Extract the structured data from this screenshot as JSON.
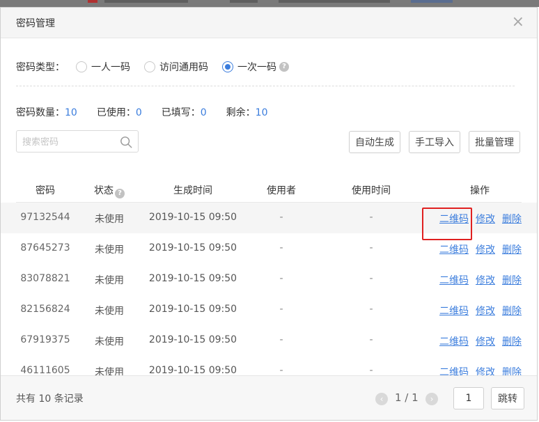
{
  "dialog": {
    "title": "密码管理",
    "close_symbol": "×"
  },
  "password_type": {
    "label": "密码类型：",
    "options": [
      {
        "label": "一人一码",
        "checked": false
      },
      {
        "label": "访问通用码",
        "checked": false
      },
      {
        "label": "一次一码",
        "checked": true
      }
    ],
    "help_symbol": "?"
  },
  "stats": {
    "count_label": "密码数量：",
    "count_value": "10",
    "used_label": "已使用：",
    "used_value": "0",
    "filled_label": "已填写：",
    "filled_value": "0",
    "remaining_label": "剩余：",
    "remaining_value": "10"
  },
  "search": {
    "placeholder": "搜索密码"
  },
  "toolbar": {
    "auto_generate": "自动生成",
    "manual_import": "手工导入",
    "batch_manage": "批量管理"
  },
  "table": {
    "headers": {
      "code": "密码",
      "status": "状态",
      "created": "生成时间",
      "user": "使用者",
      "use_time": "使用时间",
      "actions": "操作"
    },
    "action_labels": {
      "qrcode": "二维码",
      "edit": "修改",
      "delete": "删除"
    },
    "rows": [
      {
        "code": "97132544",
        "status": "未使用",
        "created": "2019-10-15 09:50",
        "user": "-",
        "use_time": "-"
      },
      {
        "code": "87645273",
        "status": "未使用",
        "created": "2019-10-15 09:50",
        "user": "-",
        "use_time": "-"
      },
      {
        "code": "83078821",
        "status": "未使用",
        "created": "2019-10-15 09:50",
        "user": "-",
        "use_time": "-"
      },
      {
        "code": "82156824",
        "status": "未使用",
        "created": "2019-10-15 09:50",
        "user": "-",
        "use_time": "-"
      },
      {
        "code": "67919375",
        "status": "未使用",
        "created": "2019-10-15 09:50",
        "user": "-",
        "use_time": "-"
      },
      {
        "code": "46111605",
        "status": "未使用",
        "created": "2019-10-15 09:50",
        "user": "-",
        "use_time": "-"
      }
    ]
  },
  "footer": {
    "total_text": "共有 10 条记录",
    "page_info": "1 / 1",
    "page_input_value": "1",
    "jump_label": "跳转",
    "prev_symbol": "‹",
    "next_symbol": "›"
  },
  "colors": {
    "accent": "#3b7ddd",
    "highlight": "#e02020"
  }
}
